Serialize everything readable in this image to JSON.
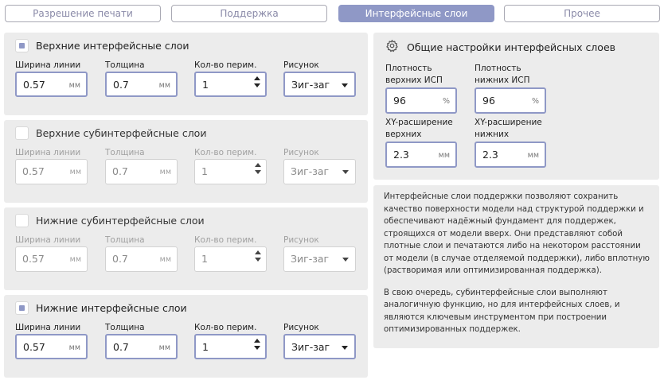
{
  "tabs": [
    {
      "label": "Разрешение печати",
      "active": false
    },
    {
      "label": "Поддержка",
      "active": false
    },
    {
      "label": "Интерфейсные слои",
      "active": true
    },
    {
      "label": "Прочее",
      "active": false
    }
  ],
  "panels": [
    {
      "title": "Верхние интерфейсные слои",
      "checked": true,
      "fields": {
        "line_width": {
          "label": "Ширина линии",
          "value": "0.57",
          "unit": "мм"
        },
        "thickness": {
          "label": "Толщина",
          "value": "0.7",
          "unit": "мм"
        },
        "perimeters": {
          "label": "Кол-во перим.",
          "value": "1"
        },
        "pattern": {
          "label": "Рисунок",
          "value": "Зиг-заг"
        }
      }
    },
    {
      "title": "Верхние субинтерфейсные слои",
      "checked": false,
      "fields": {
        "line_width": {
          "label": "Ширина линии",
          "value": "0.57",
          "unit": "мм"
        },
        "thickness": {
          "label": "Толщина",
          "value": "0.7",
          "unit": "мм"
        },
        "perimeters": {
          "label": "Кол-во перим.",
          "value": "1"
        },
        "pattern": {
          "label": "Рисунок",
          "value": "Зиг-заг"
        }
      }
    },
    {
      "title": "Нижние субинтерфейсные слои",
      "checked": false,
      "fields": {
        "line_width": {
          "label": "Ширина линии",
          "value": "0.57",
          "unit": "мм"
        },
        "thickness": {
          "label": "Толщина",
          "value": "0.7",
          "unit": "мм"
        },
        "perimeters": {
          "label": "Кол-во перим.",
          "value": "1"
        },
        "pattern": {
          "label": "Рисунок",
          "value": "Зиг-заг"
        }
      }
    },
    {
      "title": "Нижние интерфейсные слои",
      "checked": true,
      "fields": {
        "line_width": {
          "label": "Ширина линии",
          "value": "0.57",
          "unit": "мм"
        },
        "thickness": {
          "label": "Толщина",
          "value": "0.7",
          "unit": "мм"
        },
        "perimeters": {
          "label": "Кол-во перим.",
          "value": "1"
        },
        "pattern": {
          "label": "Рисунок",
          "value": "Зиг-заг"
        }
      }
    }
  ],
  "general": {
    "title": "Общие настройки интерфейсных слоев",
    "icon": "gear-icon",
    "top_density": {
      "label": "Плотность верхних ИСП",
      "value": "96",
      "unit": "%"
    },
    "bottom_density": {
      "label": "Плотность нижних ИСП",
      "value": "96",
      "unit": "%"
    },
    "xy_top": {
      "label": "XY-расширение верхних",
      "value": "2.3",
      "unit": "мм"
    },
    "xy_bottom": {
      "label": "XY-расширение нижних",
      "value": "2.3",
      "unit": "мм"
    }
  },
  "description": {
    "p1": "Интерфейсные слои поддержки позволяют сохранить качество поверхности модели над структурой поддержки и обеспечивают надёжный фундамент для поддержек, строящихся от модели вверх. Они представляют собой плотные слои и печатаются либо на некотором расстоянии от модели (в случае отделяемой поддержки), либо вплотную (растворимая или оптимизированная поддержка).",
    "p2": "В свою очередь, субинтерфейсные слои выполняют аналогичную функцию, но для интерфейсных слоев, и являются ключевым инструментом при построении оптимизированных поддержек."
  },
  "colors": {
    "accent": "#8f98c6",
    "panel_bg": "#ececec"
  }
}
